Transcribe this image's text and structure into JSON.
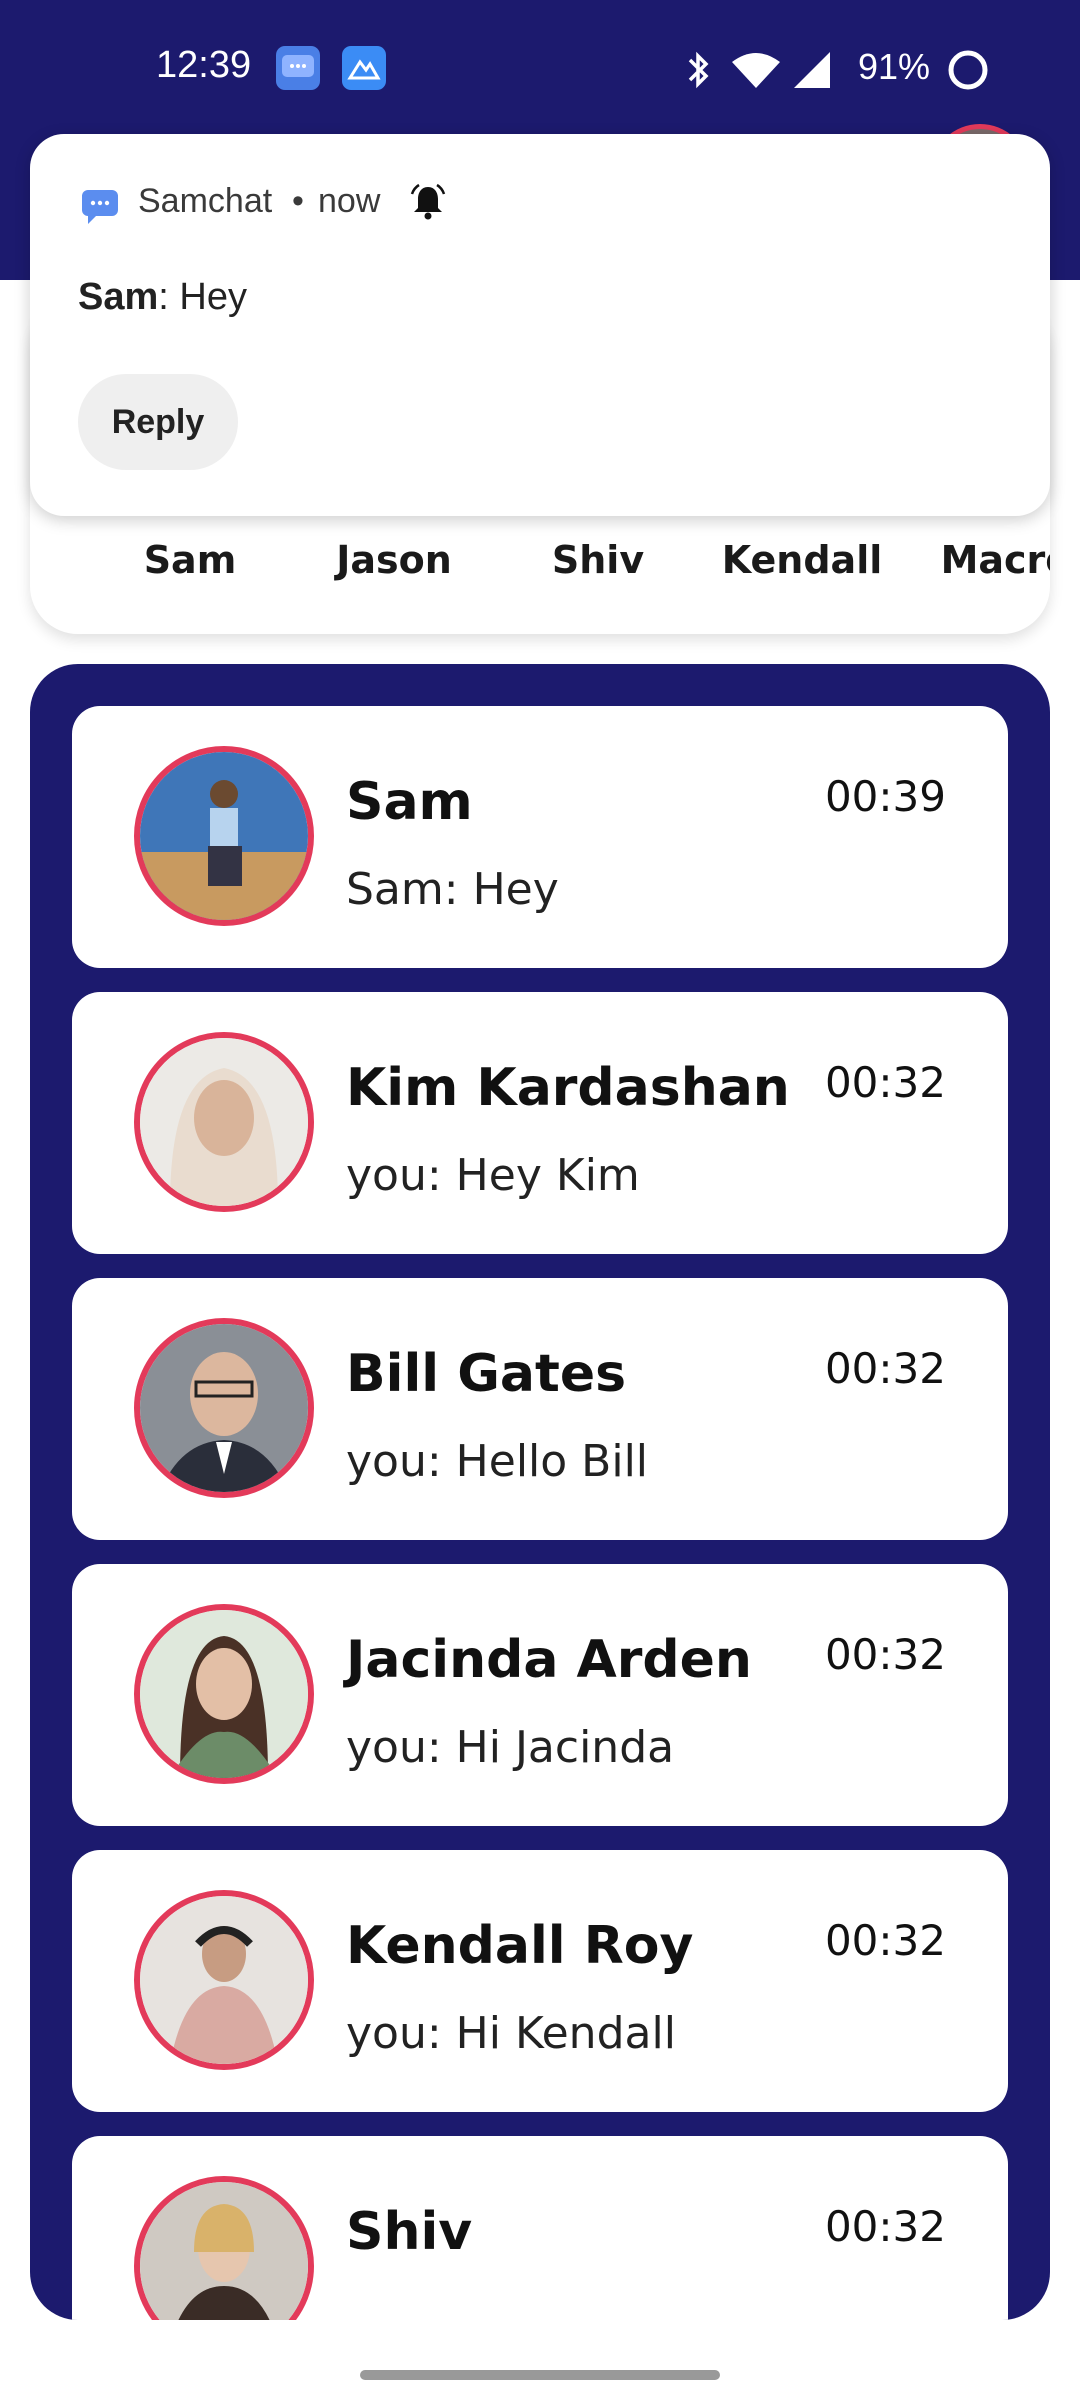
{
  "status_bar": {
    "time": "12:39",
    "battery": "91%",
    "icons": [
      "chat-app-icon",
      "mountain-app-icon",
      "bluetooth-icon",
      "wifi-icon",
      "signal-icon",
      "battery-icon"
    ]
  },
  "notification": {
    "app_name": "Samchat",
    "separator": "•",
    "time": "now",
    "sender": "Sam",
    "message": ": Hey",
    "reply_label": "Reply"
  },
  "stories": [
    {
      "name": "Sam"
    },
    {
      "name": "Jason"
    },
    {
      "name": "Shiv"
    },
    {
      "name": "Kendall"
    },
    {
      "name": "Macro"
    }
  ],
  "chats": [
    {
      "name": "Sam",
      "preview": "Sam: Hey",
      "time": "00:39"
    },
    {
      "name": "Kim Kardashan",
      "preview": "you: Hey Kim",
      "time": "00:32"
    },
    {
      "name": "Bill Gates",
      "preview": "you: Hello Bill",
      "time": "00:32"
    },
    {
      "name": "Jacinda Arden",
      "preview": "you: Hi Jacinda",
      "time": "00:32"
    },
    {
      "name": "Kendall Roy",
      "preview": "you: Hi Kendall",
      "time": "00:32"
    },
    {
      "name": "Shiv",
      "preview": "",
      "time": "00:32"
    }
  ],
  "colors": {
    "header": "#1c1a6e",
    "avatar_ring": "#e33a5a"
  }
}
